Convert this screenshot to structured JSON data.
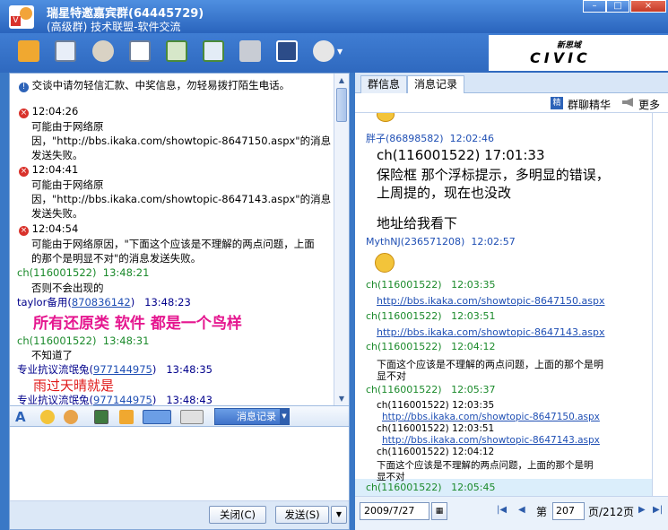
{
  "window": {
    "title": "瑞星特邀嘉宾群(64445729)",
    "subtitle": "(高级群) 技术联盟-软件交流",
    "controls": [
      "–",
      "□",
      "×"
    ]
  },
  "ad": {
    "line1": "新思域",
    "line2": "CIVIC"
  },
  "chat": {
    "notice": "交谈中请勿轻信汇款、中奖信息，勿轻易拨打陌生电话。",
    "errors": [
      {
        "time": "12:04:26",
        "lines": [
          "可能由于网络原",
          "因，\"http://bbs.ikaka.com/showtopic-8647150.aspx\"的消息",
          "发送失败。"
        ]
      },
      {
        "time": "12:04:41",
        "lines": [
          "可能由于网络原",
          "因，\"http://bbs.ikaka.com/showtopic-8647143.aspx\"的消息",
          "发送失败。"
        ]
      },
      {
        "time": "12:04:54",
        "lines": [
          "可能由于网络原因，\"下面这个应该是不理解的两点问题，上面",
          "的那个是明显不对\"的消息发送失败。"
        ]
      }
    ],
    "m1": {
      "sender": "ch(116001522)",
      "time": "13:48:21",
      "text": "否则不会出现的"
    },
    "m2": {
      "sender": "taylor备用",
      "qq": "870836142",
      "time": "13:48:23",
      "text": "所有还原类  软件  都是一个鸟样"
    },
    "m3": {
      "sender": "ch(116001522)",
      "time": "13:48:31",
      "text": "不知道了"
    },
    "m4": {
      "sender": "专业抗议流氓兔",
      "qq": "977144975",
      "time": "13:48:35",
      "text": "雨过天晴就是"
    },
    "m5": {
      "sender": "专业抗议流氓兔",
      "qq": "977144975",
      "time": "13:48:43"
    }
  },
  "formatbar": {
    "msglog_label": "消息记录"
  },
  "buttons": {
    "close": "关闭(C)",
    "send": "发送(S)"
  },
  "right": {
    "tabs": [
      "群信息",
      "消息记录"
    ],
    "digest": "群聊精华",
    "digest_badge": "精",
    "more": "更多",
    "log": {
      "r1": {
        "sender": "胖子(86898582)",
        "time": "12:02:46"
      },
      "r1_body": [
        "ch(116001522)  17:01:33",
        "保险框 那个浮标提示，多明显的错误，",
        "上周提的，现在也没改",
        "地址给我看下"
      ],
      "r2": {
        "sender": "MythNJ(236571208)",
        "time": "12:02:57"
      },
      "r3": {
        "sender": "ch(116001522)",
        "time": "12:03:35",
        "link": "http://bbs.ikaka.com/showtopic-8647150.aspx"
      },
      "r4": {
        "sender": "ch(116001522)",
        "time": "12:03:51",
        "link": "http://bbs.ikaka.com/showtopic-8647143.aspx"
      },
      "r5": {
        "sender": "ch(116001522)",
        "time": "12:04:12",
        "text": [
          "下面这个应该是不理解的两点问题，上面的那个是明",
          "显不对"
        ]
      },
      "r6": {
        "sender": "ch(116001522)",
        "time": "12:05:37",
        "lines": [
          "ch(116001522)    12:03:35",
          "http://bbs.ikaka.com/showtopic-8647150.aspx",
          "ch(116001522)    12:03:51",
          "http://bbs.ikaka.com/showtopic-8647143.aspx",
          "ch(116001522)    12:04:12",
          "下面这个应该是不理解的两点问题，上面的那个是明",
          "显不对"
        ]
      },
      "r7": {
        "sender": "ch(116001522)",
        "time": "12:05:45"
      }
    },
    "pager": {
      "date": "2009/7/27",
      "page_prefix": "第",
      "page": "207",
      "page_suffix": "页/212页"
    }
  }
}
